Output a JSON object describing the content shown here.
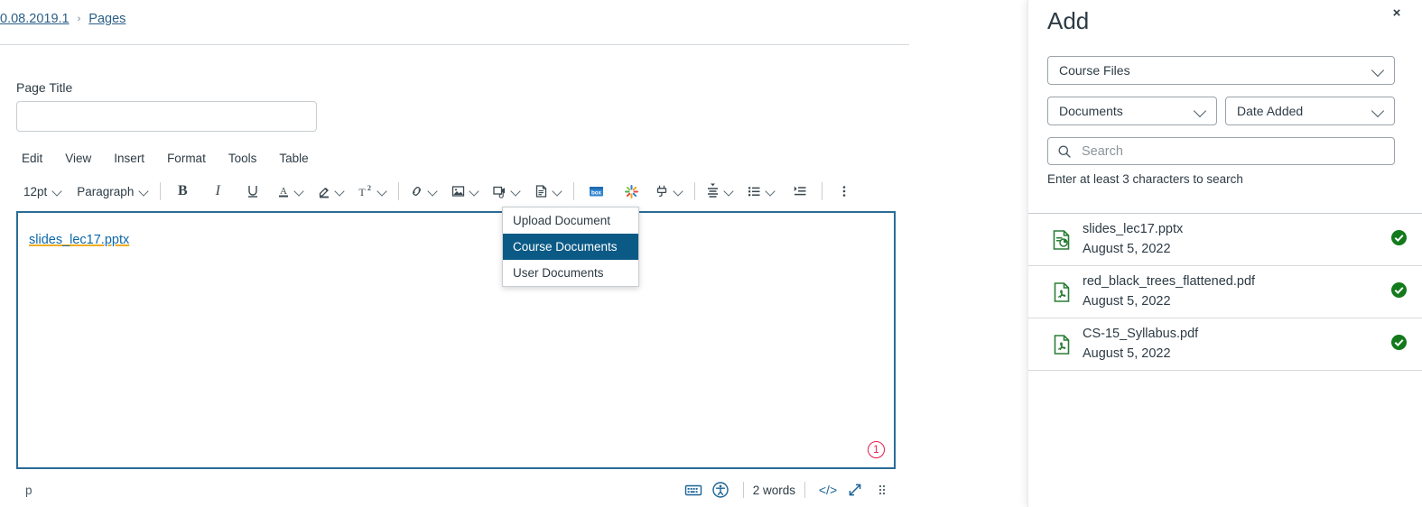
{
  "breadcrumb": {
    "items": [
      {
        "label": "0.08.2019.1"
      },
      {
        "label": "Pages"
      }
    ],
    "separator": "›"
  },
  "page_form": {
    "title_label": "Page Title",
    "title_value": "",
    "title_placeholder": ""
  },
  "editor": {
    "menubar": [
      {
        "label": "Edit"
      },
      {
        "label": "View"
      },
      {
        "label": "Insert"
      },
      {
        "label": "Format"
      },
      {
        "label": "Tools"
      },
      {
        "label": "Table"
      }
    ],
    "toolbar": {
      "font_size": "12pt",
      "block_format": "Paragraph",
      "bold_label": "B",
      "italic_label": "I",
      "superscript_label": "T",
      "superscript_sup": "2",
      "icons": [
        "underline-icon",
        "text-color-icon",
        "highlight-icon",
        "superscript-icon",
        "link-icon",
        "image-icon",
        "media-icon",
        "document-icon",
        "box-icon",
        "kaltura-icon",
        "apps-plug-icon",
        "align-icon",
        "bullet-list-icon",
        "indent-icon",
        "more-options-icon"
      ]
    },
    "content": {
      "link_text": "slides_lec17.pptx",
      "link_spell_part": "slides_",
      "link_rest": "lec17.pptx"
    },
    "annotation": {
      "marker": "1"
    },
    "statusbar": {
      "path": "p",
      "word_count": "2 words",
      "html_editor_label": "</>",
      "keyboard_icon": "keyboard-shortcuts-icon",
      "a11y_icon": "accessibility-checker-icon",
      "fullscreen_icon": "fullscreen-icon",
      "resize_icon": "resize-handle-icon"
    }
  },
  "document_menu": {
    "items": [
      {
        "label": "Upload Document",
        "selected": false
      },
      {
        "label": "Course Documents",
        "selected": true
      },
      {
        "label": "User Documents",
        "selected": false
      }
    ]
  },
  "panel": {
    "title": "Add",
    "close_label": "×",
    "filters": {
      "source": {
        "value": "Course Files"
      },
      "type": {
        "value": "Documents"
      },
      "sort": {
        "value": "Date Added"
      }
    },
    "search": {
      "placeholder": "Search",
      "value": "",
      "hint": "Enter at least 3 characters to search"
    },
    "files": [
      {
        "name": "slides_lec17.pptx",
        "date": "August 5, 2022",
        "icon": "powerpoint-file-icon",
        "published": true
      },
      {
        "name": "red_black_trees_flattened.pdf",
        "date": "August 5, 2022",
        "icon": "pdf-file-icon",
        "published": true
      },
      {
        "name": "CS-15_Syllabus.pdf",
        "date": "August 5, 2022",
        "icon": "pdf-file-icon",
        "published": true
      }
    ]
  },
  "colors": {
    "link": "#0e68a8",
    "menu_selected_bg": "#0b5a86",
    "editor_border": "#2b6c96",
    "annotation": "#e31b4d",
    "published_green": "#127a1b",
    "file_icon_green": "#2a7d36"
  }
}
